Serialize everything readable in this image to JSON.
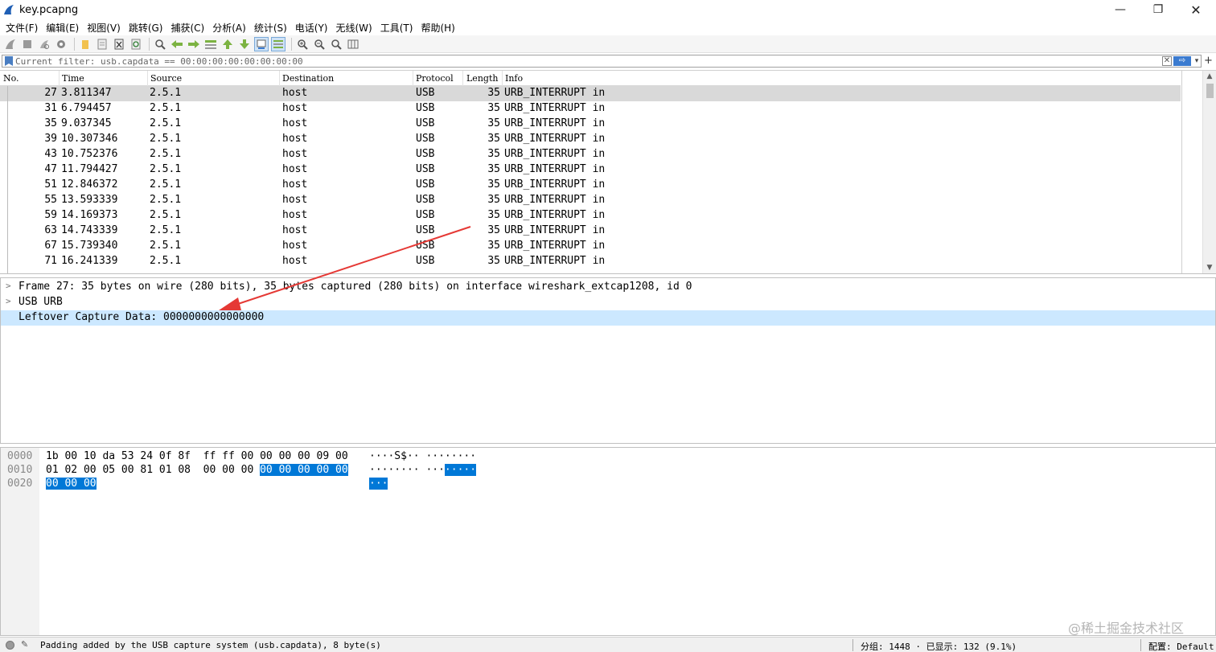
{
  "window": {
    "title": "key.pcapng",
    "minimize": "—",
    "maximize": "❐",
    "close": "✕"
  },
  "menu": [
    "文件(F)",
    "编辑(E)",
    "视图(V)",
    "跳转(G)",
    "捕获(C)",
    "分析(A)",
    "统计(S)",
    "电话(Y)",
    "无线(W)",
    "工具(T)",
    "帮助(H)"
  ],
  "toolbar": {
    "icons": [
      "shark-fin-start-icon",
      "stop-icon",
      "restart-icon",
      "options-gear-icon",
      "open-folder-icon",
      "save-file-icon",
      "close-file-icon",
      "reload-icon",
      "find-icon",
      "back-arrow-icon",
      "forward-arrow-icon",
      "go-to-packet-icon",
      "first-packet-icon",
      "last-packet-icon",
      "autoscroll-icon",
      "colorize-icon",
      "zoom-in-icon",
      "zoom-out-icon",
      "zoom-normal-icon",
      "resize-columns-icon"
    ]
  },
  "filter": {
    "value": "Current filter: usb.capdata == 00:00:00:00:00:00:00:00",
    "clear": "✕",
    "apply": "⇨",
    "plus": "+"
  },
  "packet_list": {
    "columns": [
      "No.",
      "Time",
      "Source",
      "Destination",
      "Protocol",
      "Length",
      "Info"
    ],
    "rows": [
      {
        "no": "27",
        "time": "3.811347",
        "source": "2.5.1",
        "destination": "host",
        "protocol": "USB",
        "length": "35",
        "info": "URB_INTERRUPT in"
      },
      {
        "no": "31",
        "time": "6.794457",
        "source": "2.5.1",
        "destination": "host",
        "protocol": "USB",
        "length": "35",
        "info": "URB_INTERRUPT in"
      },
      {
        "no": "35",
        "time": "9.037345",
        "source": "2.5.1",
        "destination": "host",
        "protocol": "USB",
        "length": "35",
        "info": "URB_INTERRUPT in"
      },
      {
        "no": "39",
        "time": "10.307346",
        "source": "2.5.1",
        "destination": "host",
        "protocol": "USB",
        "length": "35",
        "info": "URB_INTERRUPT in"
      },
      {
        "no": "43",
        "time": "10.752376",
        "source": "2.5.1",
        "destination": "host",
        "protocol": "USB",
        "length": "35",
        "info": "URB_INTERRUPT in"
      },
      {
        "no": "47",
        "time": "11.794427",
        "source": "2.5.1",
        "destination": "host",
        "protocol": "USB",
        "length": "35",
        "info": "URB_INTERRUPT in"
      },
      {
        "no": "51",
        "time": "12.846372",
        "source": "2.5.1",
        "destination": "host",
        "protocol": "USB",
        "length": "35",
        "info": "URB_INTERRUPT in"
      },
      {
        "no": "55",
        "time": "13.593339",
        "source": "2.5.1",
        "destination": "host",
        "protocol": "USB",
        "length": "35",
        "info": "URB_INTERRUPT in"
      },
      {
        "no": "59",
        "time": "14.169373",
        "source": "2.5.1",
        "destination": "host",
        "protocol": "USB",
        "length": "35",
        "info": "URB_INTERRUPT in"
      },
      {
        "no": "63",
        "time": "14.743339",
        "source": "2.5.1",
        "destination": "host",
        "protocol": "USB",
        "length": "35",
        "info": "URB_INTERRUPT in"
      },
      {
        "no": "67",
        "time": "15.739340",
        "source": "2.5.1",
        "destination": "host",
        "protocol": "USB",
        "length": "35",
        "info": "URB_INTERRUPT in"
      },
      {
        "no": "71",
        "time": "16.241339",
        "source": "2.5.1",
        "destination": "host",
        "protocol": "USB",
        "length": "35",
        "info": "URB_INTERRUPT in"
      }
    ]
  },
  "details": [
    {
      "expander": ">",
      "text": "Frame 27: 35 bytes on wire (280 bits), 35 bytes captured (280 bits) on interface wireshark_extcap1208, id 0"
    },
    {
      "expander": ">",
      "text": "USB URB"
    },
    {
      "expander": "",
      "text": "Leftover Capture Data: 0000000000000000"
    }
  ],
  "bytes": [
    {
      "offset": "0000",
      "hex": "1b 00 10 da 53 24 0f 8f  ff ff 00 00 00 00 09 00",
      "hex_hl": "",
      "ascii": "····S$·· ········",
      "ascii_hl": ""
    },
    {
      "offset": "0010",
      "hex": "01 02 00 05 00 81 01 08  00 00 00 ",
      "hex_hl": "00 00 00 00 00",
      "ascii": "········ ···",
      "ascii_hl": "·····"
    },
    {
      "offset": "0020",
      "hex": "",
      "hex_hl": "00 00 00",
      "ascii": "",
      "ascii_hl": "···"
    }
  ],
  "watermark": "@稀土掘金技术社区",
  "status": {
    "field_info": "Padding added by the USB capture system (usb.capdata), 8 byte(s)",
    "packets": "分组: 1448 · 已显示: 132 (9.1%)",
    "profile": "配置: Default"
  },
  "colors": {
    "selection_row": "#d9d9d9",
    "detail_highlight": "#cce8ff",
    "byte_highlight": "#0078d7",
    "annotation_arrow": "#e53935"
  }
}
